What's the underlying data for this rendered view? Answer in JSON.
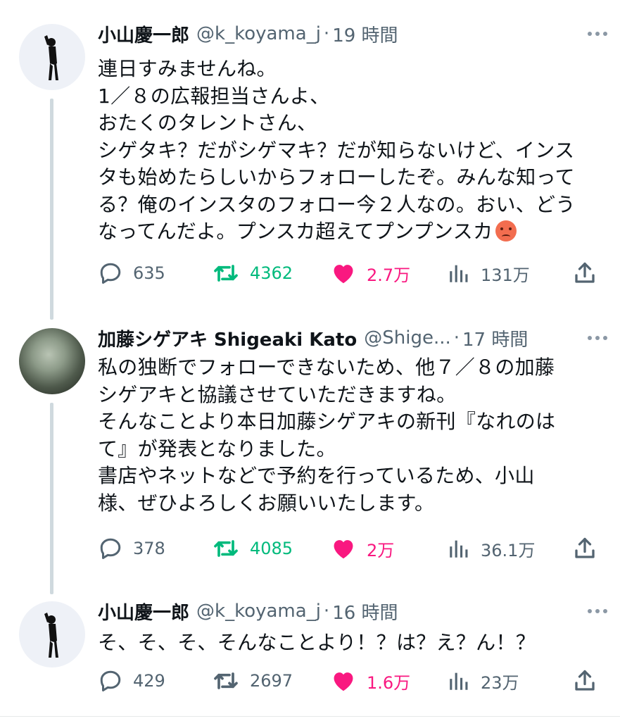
{
  "tweets": [
    {
      "name": "小山慶一郎",
      "handle": "@k_koyama_j",
      "dot": "·",
      "time": "19 時間",
      "lines": [
        "連日すみませんね。",
        "1／８の広報担当さんよ、",
        "おたくのタレントさん、",
        "シゲタキ？だがシゲマキ？だが知らないけど、インス",
        "タも始めたらしいからフォローしたぞ。みんな知って",
        "る？俺のインスタのフォロー今２人なの。おい、どう",
        "なってんだよ。プンスカ超えてプンプンスカ"
      ],
      "emoji": "pouting-face",
      "replies": "635",
      "retweets": "4362",
      "likes": "2.7万",
      "views": "131万"
    },
    {
      "name": "加藤シゲアキ Shigeaki Kato",
      "handle": "@Shige...",
      "dot": "·",
      "time": "17 時間",
      "lines": [
        "私の独断でフォローできないため、他７／８の加藤",
        "シゲアキと協議させていただきますね。",
        "そんなことより本日加藤シゲアキの新刊『なれのは",
        "て』が発表となりました。",
        "書店やネットなどで予約を行っているため、小山",
        "様、ぜひよろしくお願いいたします。"
      ],
      "replies": "378",
      "retweets": "4085",
      "likes": "2万",
      "views": "36.1万"
    },
    {
      "name": "小山慶一郎",
      "handle": "@k_koyama_j",
      "dot": "·",
      "time": "16 時間",
      "lines": [
        "そ、そ、そ、そんなことより！？は？え？ん！？"
      ],
      "replies": "429",
      "retweets": "2697",
      "likes": "1.6万",
      "views": "23万"
    }
  ],
  "colors": {
    "text": "#0f1419",
    "secondary": "#536471",
    "retweet_active": "#00ba7c",
    "like_active": "#f91880",
    "thread_line": "#cfd9de"
  },
  "icons": [
    "reply-icon",
    "retweet-icon",
    "like-icon",
    "views-icon",
    "share-icon",
    "more-icon"
  ]
}
